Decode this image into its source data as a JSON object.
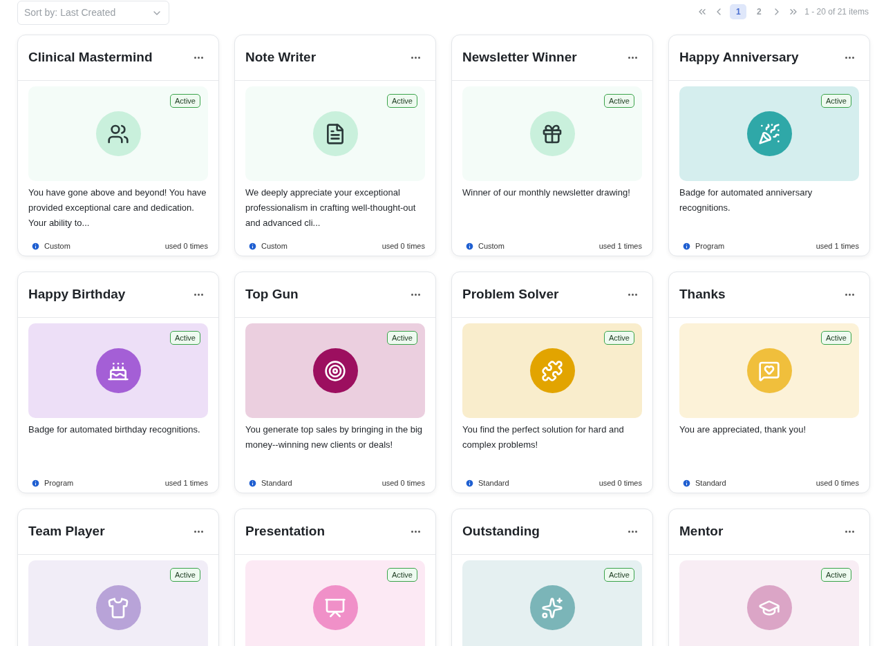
{
  "sort": {
    "label": "Sort by: Last Created"
  },
  "pagination": {
    "pages": [
      {
        "label": "1",
        "selected": true
      },
      {
        "label": "2",
        "selected": false
      }
    ],
    "summary": "1 - 20 of 21 items"
  },
  "cards": [
    {
      "title": "Clinical Mastermind",
      "status": "Active",
      "kind": "people",
      "color": "#c9f0dc",
      "description": "You have gone above and beyond! You have provided exceptional care and dedication. Your ability to...",
      "type": "Custom",
      "usage": "used 0 times"
    },
    {
      "title": "Note Writer",
      "status": "Active",
      "kind": "document",
      "color": "#c9f0dc",
      "description": "We deeply appreciate your exceptional professionalism in crafting well-thought-out and advanced cli...",
      "type": "Custom",
      "usage": "used 0 times"
    },
    {
      "title": "Newsletter Winner",
      "status": "Active",
      "kind": "gift",
      "color": "#c9f0dc",
      "description": "Winner of our monthly newsletter drawing!",
      "type": "Custom",
      "usage": "used 1 times"
    },
    {
      "title": "Happy Anniversary",
      "status": "Active",
      "kind": "party",
      "color": "#2fa8a8",
      "description": "Badge for automated anniversary recognitions.",
      "type": "Program",
      "usage": "used 1 times"
    },
    {
      "title": "Happy Birthday",
      "status": "Active",
      "kind": "cake",
      "color": "#a45fd6",
      "description": "Badge for automated birthday recognitions.",
      "type": "Program",
      "usage": "used 1 times"
    },
    {
      "title": "Top Gun",
      "status": "Active",
      "kind": "target",
      "color": "#9c0f5f",
      "description": "You generate top sales by bringing in the big money--winning new clients or deals!",
      "type": "Standard",
      "usage": "used 0 times"
    },
    {
      "title": "Problem Solver",
      "status": "Active",
      "kind": "puzzle",
      "color": "#e2a400",
      "description": "You find the perfect solution for hard and complex problems!",
      "type": "Standard",
      "usage": "used 0 times"
    },
    {
      "title": "Thanks",
      "status": "Active",
      "kind": "heart-chat",
      "color": "#f0bf3c",
      "description": "You are appreciated, thank you!",
      "type": "Standard",
      "usage": "used 0 times"
    },
    {
      "title": "Team Player",
      "status": "Active",
      "kind": "shirt",
      "color": "#b8a3d8"
    },
    {
      "title": "Presentation",
      "status": "Active",
      "kind": "presentation",
      "color": "#f090c8"
    },
    {
      "title": "Outstanding",
      "status": "Active",
      "kind": "stars",
      "color": "#7bb5b8"
    },
    {
      "title": "Mentor",
      "status": "Active",
      "kind": "cap",
      "color": "#dba5c6"
    }
  ]
}
